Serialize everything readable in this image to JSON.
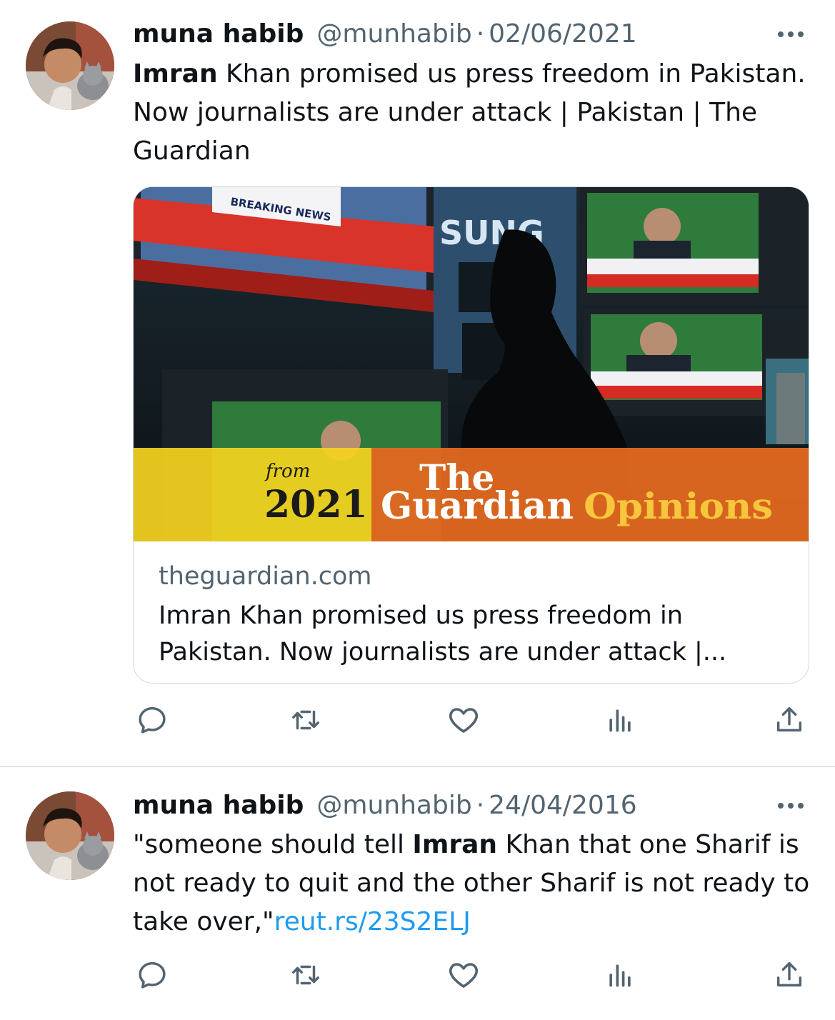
{
  "colors": {
    "text": "#0f1419",
    "secondary": "#536471",
    "link": "#1d9bf0",
    "divider": "#e1e6e9",
    "guardian_orange": "#e0681f",
    "guardian_yellow": "#f5d31e"
  },
  "tweets": [
    {
      "author_name": "muna habib",
      "handle": "@munhabib",
      "separator": "·",
      "date": "02/06/2021",
      "text": {
        "bold": "Imran",
        "rest": " Khan promised us press freedom in Pakistan. Now journalists are under attack | Pakistan | The Guardian"
      },
      "card": {
        "image_badge": {
          "from_label": "from",
          "year": "2021",
          "brand_top": "The",
          "brand_bottom": "Guardian",
          "section": "Opinions"
        },
        "image_overlay_text": {
          "breaking_news": "BREAKING NEWS",
          "brand_sign": "SUNG"
        },
        "domain": "theguardian.com",
        "title": "Imran Khan promised us press freedom in Pakistan. Now journalists are under attack |..."
      },
      "actions": [
        "reply-icon",
        "retweet-icon",
        "like-icon",
        "views-icon",
        "share-icon"
      ]
    },
    {
      "author_name": "muna habib",
      "handle": "@munhabib",
      "separator": "·",
      "date": "24/04/2016",
      "text": {
        "pre": "\"someone should tell ",
        "bold": "Imran",
        "post": " Khan that one Sharif is not ready to quit and the other Sharif is not ready to take over,\"",
        "link": "reut.rs/23S2ELJ"
      },
      "actions": [
        "reply-icon",
        "retweet-icon",
        "like-icon",
        "views-icon",
        "share-icon"
      ]
    }
  ]
}
